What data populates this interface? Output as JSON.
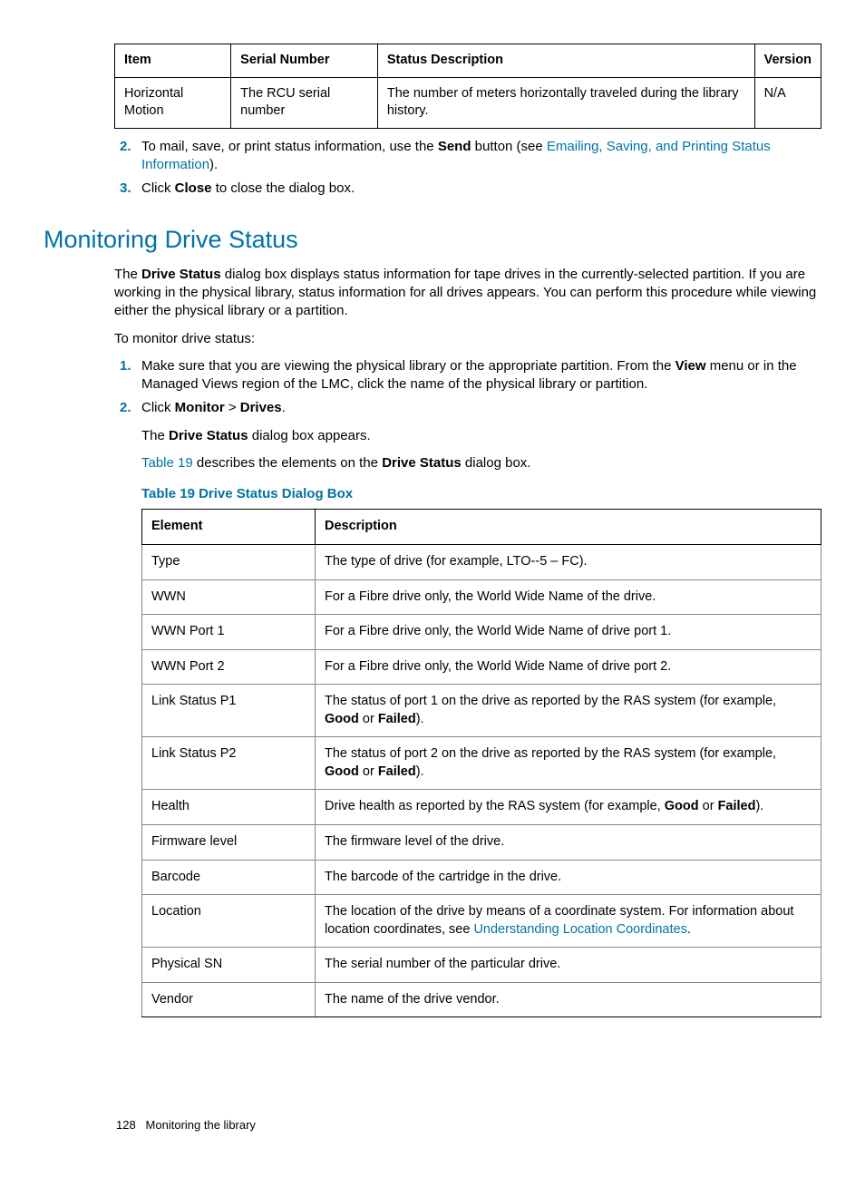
{
  "topTable": {
    "headers": [
      "Item",
      "Serial Number",
      "Status Description",
      "Version"
    ],
    "row": [
      "Horizontal Motion",
      "The RCU serial number",
      "The number of meters horizontally traveled during the library history.",
      "N/A"
    ]
  },
  "list1": {
    "item2_pre": "To mail, save, or print status information, use the ",
    "item2_b1": "Send",
    "item2_mid": " button (see ",
    "item2_link": "Emailing, Saving, and Printing Status Information",
    "item2_end": ").",
    "item3_pre": "Click ",
    "item3_b": "Close",
    "item3_end": " to close the dialog box."
  },
  "sectionTitle": "Monitoring Drive Status",
  "intro_pre": "The ",
  "intro_b": "Drive Status",
  "intro_rest": " dialog box displays status information for tape drives in the currently-selected partition. If you are working in the physical library, status information for all drives appears. You can perform this procedure while viewing either the physical library or a partition.",
  "intro2": "To monitor drive status:",
  "list2": {
    "i1_pre": "Make sure that you are viewing the physical library or the appropriate partition. From the ",
    "i1_b": "View",
    "i1_rest": " menu or in the Managed Views region of the LMC, click the name of the physical library or partition.",
    "i2_pre": "Click ",
    "i2_b1": "Monitor",
    "i2_sep": " > ",
    "i2_b2": "Drives",
    "i2_end": ".",
    "i2_sub_pre": "The ",
    "i2_sub_b": "Drive Status",
    "i2_sub_end": " dialog box appears.",
    "i2_sub2_link": "Table 19",
    "i2_sub2_mid": " describes the elements on the ",
    "i2_sub2_b": "Drive Status",
    "i2_sub2_end": " dialog box."
  },
  "tableCaption": "Table 19 Drive Status Dialog Box",
  "t2": {
    "h1": "Element",
    "h2": "Description",
    "r1e": "Type",
    "r1d": "The type of drive (for example, LTO--5 – FC).",
    "r2e": "WWN",
    "r2d": "For a Fibre drive only, the World Wide Name of the drive.",
    "r3e": "WWN Port 1",
    "r3d": "For a Fibre drive only, the World Wide Name of drive port 1.",
    "r4e": "WWN Port 2",
    "r4d": "For a Fibre drive only, the World Wide Name of drive port 2.",
    "r5e": "Link Status P1",
    "r5d_pre": "The status of port 1 on the drive as reported by the RAS system (for example, ",
    "r5d_b1": "Good",
    "r5d_or": " or ",
    "r5d_b2": "Failed",
    "r5d_end": ").",
    "r6e": "Link Status P2",
    "r6d_pre": "The status of port 2 on the drive as reported by the RAS system (for example, ",
    "r6d_b1": "Good",
    "r6d_or": " or ",
    "r6d_b2": "Failed",
    "r6d_end": ").",
    "r7e": "Health",
    "r7d_pre": "Drive health as reported by the RAS system (for example, ",
    "r7d_b1": "Good",
    "r7d_or": " or ",
    "r7d_b2": "Failed",
    "r7d_end": ").",
    "r8e": "Firmware level",
    "r8d": "The firmware level of the drive.",
    "r9e": "Barcode",
    "r9d": "The barcode of the cartridge in the drive.",
    "r10e": "Location",
    "r10d_pre": "The location of the drive by means of a coordinate system. For information about location coordinates, see ",
    "r10d_link": "Understanding Location Coordinates",
    "r10d_end": ".",
    "r11e": "Physical SN",
    "r11d": "The serial number of the particular drive.",
    "r12e": "Vendor",
    "r12d": "The name of the drive vendor."
  },
  "footer_page": "128",
  "footer_text": "Monitoring the library"
}
